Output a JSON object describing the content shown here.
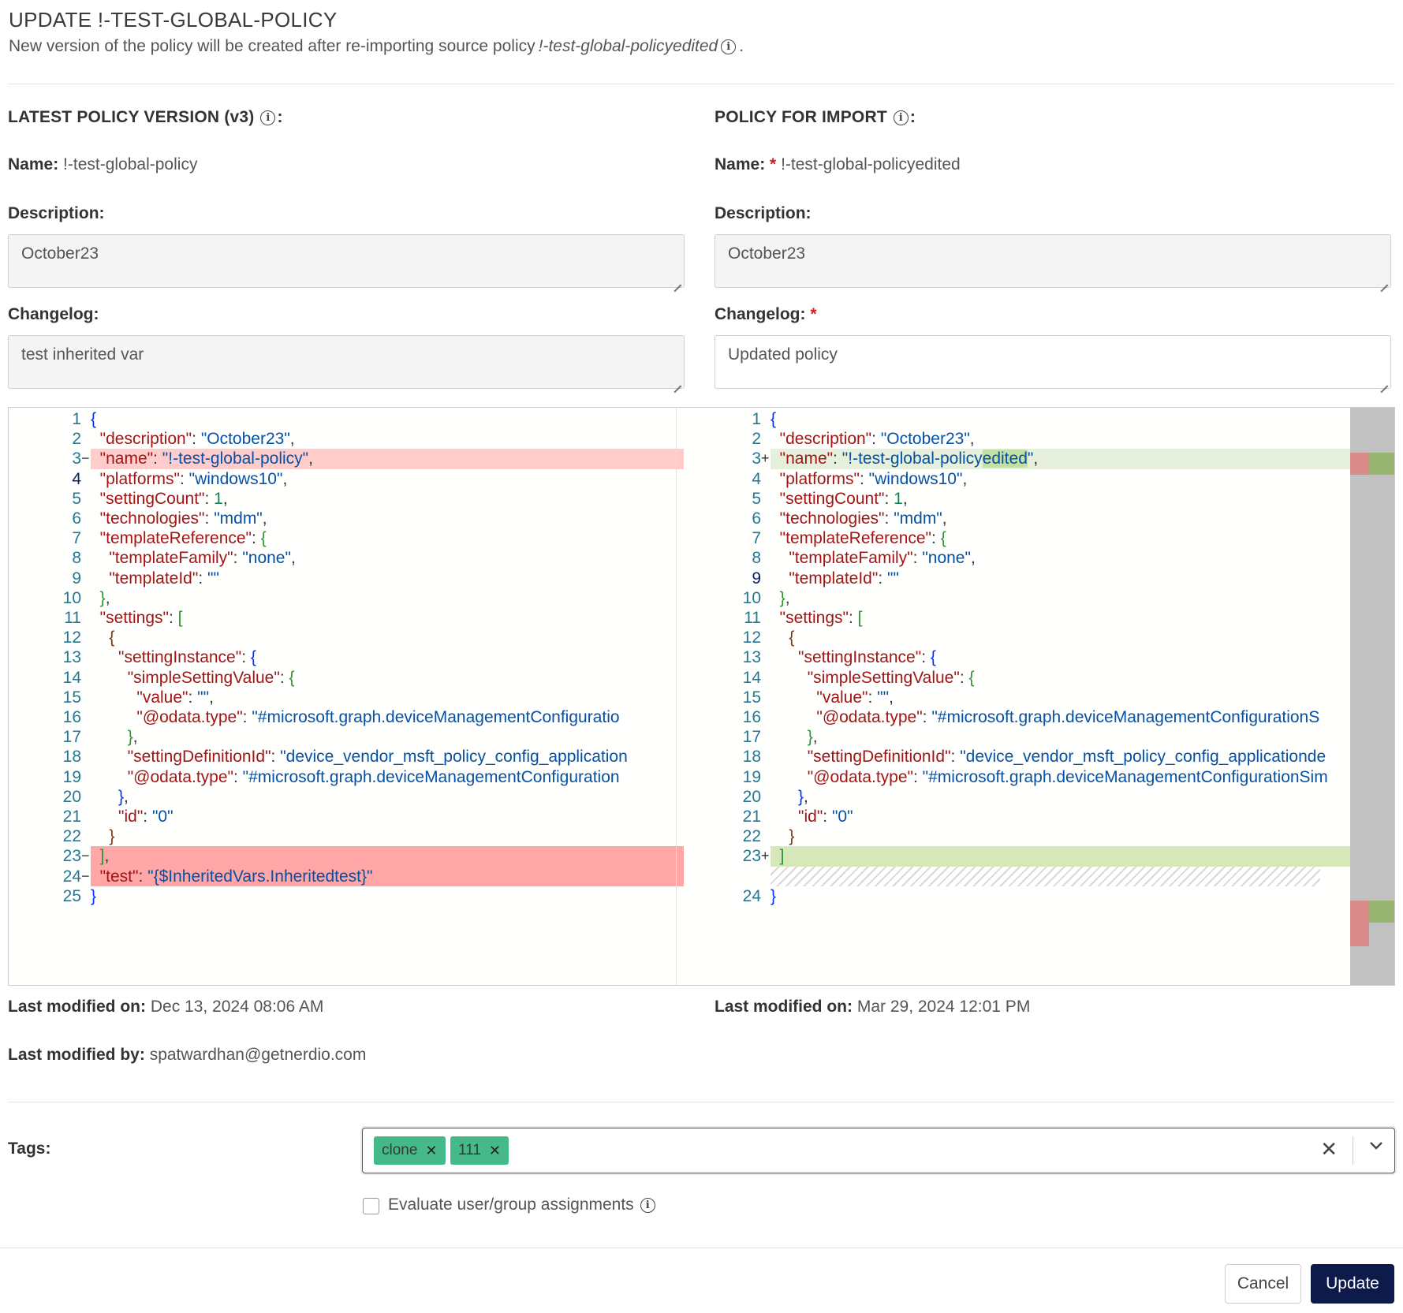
{
  "modal": {
    "title": "UPDATE !-TEST-GLOBAL-POLICY",
    "subtitle_prefix": "New version of the policy will be created after re-importing source policy",
    "subtitle_policy": "!-test-global-policyedited",
    "subtitle_suffix": "."
  },
  "left": {
    "heading": "LATEST POLICY VERSION (v3)",
    "name_label": "Name:",
    "name_value": "!-test-global-policy",
    "description_label": "Description:",
    "description_value": "October23",
    "changelog_label": "Changelog:",
    "changelog_value": "test inherited var",
    "last_modified_on_label": "Last modified on:",
    "last_modified_on_value": "Dec 13, 2024 08:06 AM",
    "last_modified_by_label": "Last modified by:",
    "last_modified_by_value": "spatwardhan@getnerdio.com"
  },
  "right": {
    "heading": "POLICY FOR IMPORT",
    "name_label": "Name:",
    "name_required": "*",
    "name_value": "!-test-global-policyedited",
    "description_label": "Description:",
    "description_value": "October23",
    "changelog_label": "Changelog:",
    "changelog_required": "*",
    "changelog_value": "Updated policy",
    "last_modified_on_label": "Last modified on:",
    "last_modified_on_value": "Mar 29, 2024 12:01 PM"
  },
  "diff": {
    "left_lines": [
      {
        "n": "1",
        "m": "",
        "c": "{",
        "bg": ""
      },
      {
        "n": "2",
        "m": "",
        "c": "  \"description\": \"October23\",",
        "bg": ""
      },
      {
        "n": "3",
        "m": "−",
        "c": "  \"name\": \"!-test-global-policy\",",
        "bg": "del"
      },
      {
        "n": "4",
        "m": "",
        "c": "  \"platforms\": \"windows10\",",
        "bg": ""
      },
      {
        "n": "5",
        "m": "",
        "c": "  \"settingCount\": 1,",
        "bg": ""
      },
      {
        "n": "6",
        "m": "",
        "c": "  \"technologies\": \"mdm\",",
        "bg": ""
      },
      {
        "n": "7",
        "m": "",
        "c": "  \"templateReference\": {",
        "bg": ""
      },
      {
        "n": "8",
        "m": "",
        "c": "    \"templateFamily\": \"none\",",
        "bg": ""
      },
      {
        "n": "9",
        "m": "",
        "c": "    \"templateId\": \"\"",
        "bg": ""
      },
      {
        "n": "10",
        "m": "",
        "c": "  },",
        "bg": ""
      },
      {
        "n": "11",
        "m": "",
        "c": "  \"settings\": [",
        "bg": ""
      },
      {
        "n": "12",
        "m": "",
        "c": "    {",
        "bg": ""
      },
      {
        "n": "13",
        "m": "",
        "c": "      \"settingInstance\": {",
        "bg": ""
      },
      {
        "n": "14",
        "m": "",
        "c": "        \"simpleSettingValue\": {",
        "bg": ""
      },
      {
        "n": "15",
        "m": "",
        "c": "          \"value\": \"\",",
        "bg": ""
      },
      {
        "n": "16",
        "m": "",
        "c": "          \"@odata.type\": \"#microsoft.graph.deviceManagementConfiguratio",
        "bg": ""
      },
      {
        "n": "17",
        "m": "",
        "c": "        },",
        "bg": ""
      },
      {
        "n": "18",
        "m": "",
        "c": "        \"settingDefinitionId\": \"device_vendor_msft_policy_config_application",
        "bg": ""
      },
      {
        "n": "19",
        "m": "",
        "c": "        \"@odata.type\": \"#microsoft.graph.deviceManagementConfiguration",
        "bg": ""
      },
      {
        "n": "20",
        "m": "",
        "c": "      },",
        "bg": ""
      },
      {
        "n": "21",
        "m": "",
        "c": "      \"id\": \"0\"",
        "bg": ""
      },
      {
        "n": "22",
        "m": "",
        "c": "    }",
        "bg": ""
      },
      {
        "n": "23",
        "m": "−",
        "c": "  ],",
        "bg": "del-strong"
      },
      {
        "n": "24",
        "m": "−",
        "c": "  \"test\": \"{$InheritedVars.Inheritedtest}\"",
        "bg": "del-strong"
      },
      {
        "n": "25",
        "m": "",
        "c": "}",
        "bg": ""
      }
    ],
    "right_lines": [
      {
        "n": "1",
        "m": "",
        "c": "{",
        "bg": ""
      },
      {
        "n": "2",
        "m": "",
        "c": "  \"description\": \"October23\",",
        "bg": ""
      },
      {
        "n": "3",
        "m": "+",
        "c": "  \"name\": \"!-test-global-policyedited\",",
        "bg": "add"
      },
      {
        "n": "4",
        "m": "",
        "c": "  \"platforms\": \"windows10\",",
        "bg": ""
      },
      {
        "n": "5",
        "m": "",
        "c": "  \"settingCount\": 1,",
        "bg": ""
      },
      {
        "n": "6",
        "m": "",
        "c": "  \"technologies\": \"mdm\",",
        "bg": ""
      },
      {
        "n": "7",
        "m": "",
        "c": "  \"templateReference\": {",
        "bg": ""
      },
      {
        "n": "8",
        "m": "",
        "c": "    \"templateFamily\": \"none\",",
        "bg": ""
      },
      {
        "n": "9",
        "m": "",
        "c": "    \"templateId\": \"\"",
        "bg": ""
      },
      {
        "n": "10",
        "m": "",
        "c": "  },",
        "bg": ""
      },
      {
        "n": "11",
        "m": "",
        "c": "  \"settings\": [",
        "bg": ""
      },
      {
        "n": "12",
        "m": "",
        "c": "    {",
        "bg": ""
      },
      {
        "n": "13",
        "m": "",
        "c": "      \"settingInstance\": {",
        "bg": ""
      },
      {
        "n": "14",
        "m": "",
        "c": "        \"simpleSettingValue\": {",
        "bg": ""
      },
      {
        "n": "15",
        "m": "",
        "c": "          \"value\": \"\",",
        "bg": ""
      },
      {
        "n": "16",
        "m": "",
        "c": "          \"@odata.type\": \"#microsoft.graph.deviceManagementConfigurationS",
        "bg": ""
      },
      {
        "n": "17",
        "m": "",
        "c": "        },",
        "bg": ""
      },
      {
        "n": "18",
        "m": "",
        "c": "        \"settingDefinitionId\": \"device_vendor_msft_policy_config_applicationde",
        "bg": ""
      },
      {
        "n": "19",
        "m": "",
        "c": "        \"@odata.type\": \"#microsoft.graph.deviceManagementConfigurationSim",
        "bg": ""
      },
      {
        "n": "20",
        "m": "",
        "c": "      },",
        "bg": ""
      },
      {
        "n": "21",
        "m": "",
        "c": "      \"id\": \"0\"",
        "bg": ""
      },
      {
        "n": "22",
        "m": "",
        "c": "    }",
        "bg": ""
      },
      {
        "n": "23",
        "m": "+",
        "c": "  ]",
        "bg": "add-strong"
      },
      {
        "n": "",
        "m": "",
        "c": "",
        "bg": "hatch"
      },
      {
        "n": "24",
        "m": "",
        "c": "}",
        "bg": ""
      }
    ]
  },
  "tags": {
    "label": "Tags:",
    "items": [
      "clone",
      "111"
    ]
  },
  "evaluate_label": "Evaluate user/group assignments",
  "buttons": {
    "cancel": "Cancel",
    "update": "Update"
  },
  "colors": {
    "primary_button": "#0d1a4a",
    "tag_bg": "#45b98a",
    "deleted_line": "#ffcccc",
    "added_line": "#e6f0dc",
    "required": "#d21f1f"
  }
}
